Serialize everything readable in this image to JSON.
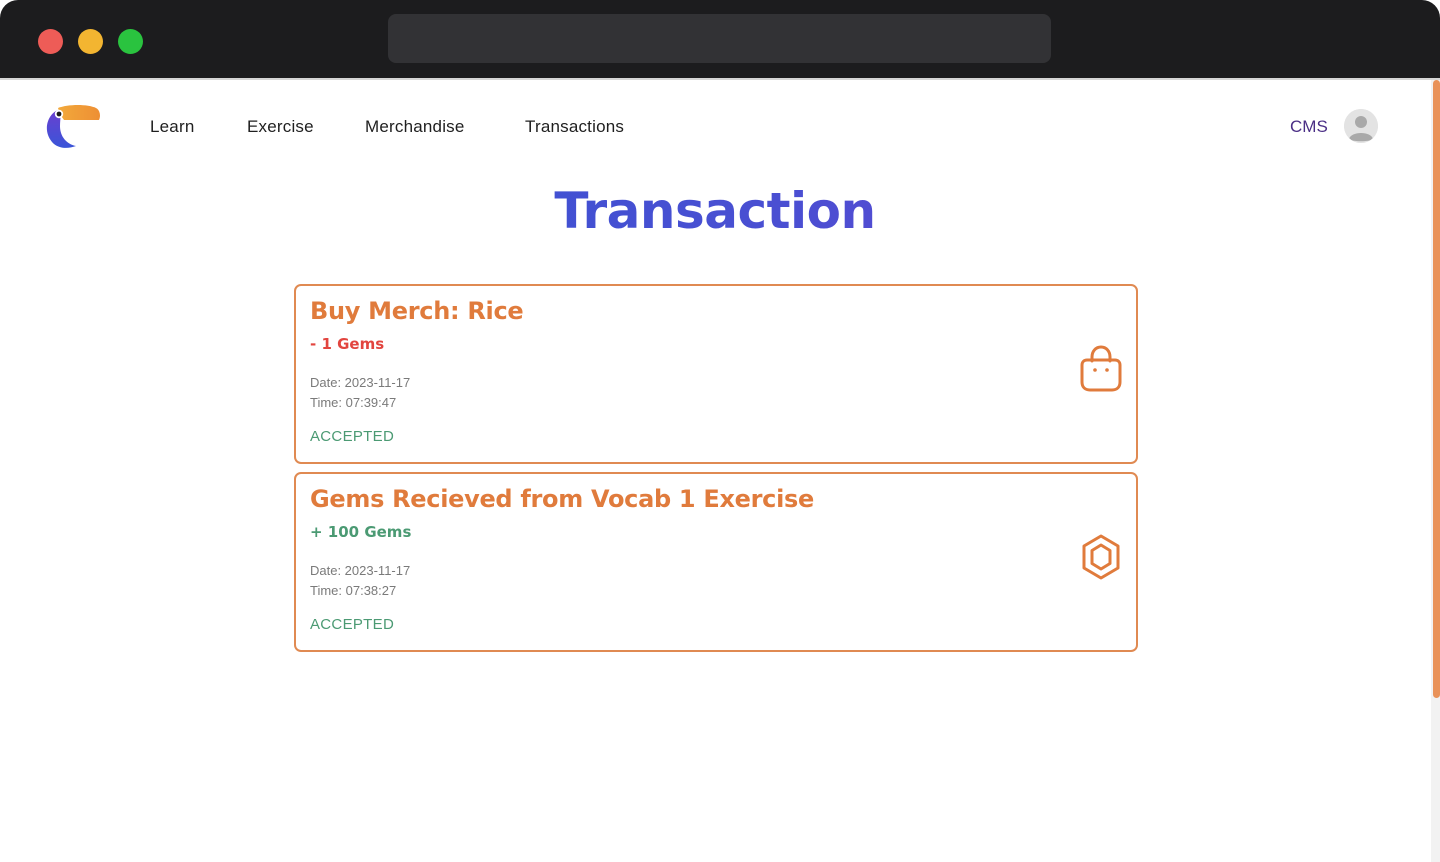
{
  "nav": {
    "items": [
      {
        "label": "Learn"
      },
      {
        "label": "Exercise"
      },
      {
        "label": "Merchandise"
      },
      {
        "label": "Transactions"
      }
    ],
    "cms_label": "CMS",
    "logo_icon": "toucan-logo-icon",
    "avatar_icon": "user-avatar-icon"
  },
  "page": {
    "title": "Transaction"
  },
  "transactions": [
    {
      "title": "Buy Merch: Rice",
      "amount": "- 1 Gems",
      "date": "Date: 2023-11-17",
      "time": "Time: 07:39:47",
      "status": "ACCEPTED",
      "icon": "shopping-bag-icon"
    },
    {
      "title": "Gems Recieved from Vocab 1 Exercise",
      "amount": "+ 100 Gems",
      "date": "Date: 2023-11-17",
      "time": "Time: 07:38:27",
      "status": "ACCEPTED",
      "icon": "gem-hexagon-icon"
    }
  ],
  "colors": {
    "accent_orange": "#e07b3c",
    "title_gradient_start": "#2f55d4",
    "title_gradient_end": "#7a3fd3",
    "negative": "#e2453f",
    "positive": "#4b9a73",
    "cms": "#4b2f86"
  }
}
